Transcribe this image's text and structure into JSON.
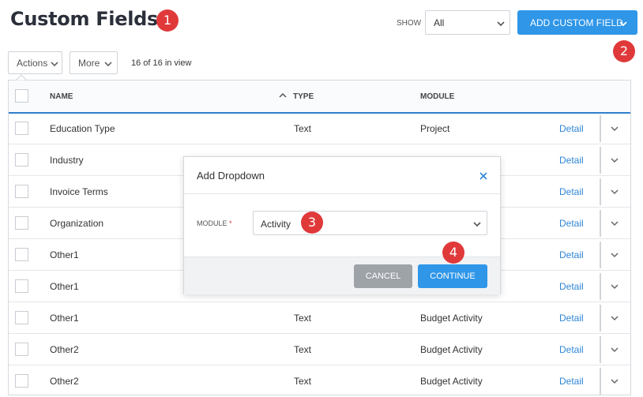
{
  "header": {
    "title": "Custom Fields",
    "show_label": "SHOW",
    "show_value": "All",
    "add_button": "ADD CUSTOM FIELD"
  },
  "toolbar": {
    "actions_label": "Actions",
    "more_label": "More",
    "in_view": "16 of 16 in view"
  },
  "table": {
    "headers": {
      "name": "NAME",
      "type": "TYPE",
      "module": "MODULE"
    },
    "detail_label": "Detail",
    "rows": [
      {
        "name": "Education Type",
        "type": "Text",
        "module": "Project"
      },
      {
        "name": "Industry",
        "type": "",
        "module": ""
      },
      {
        "name": "Invoice Terms",
        "type": "",
        "module": ""
      },
      {
        "name": "Organization",
        "type": "",
        "module": ""
      },
      {
        "name": "Other1",
        "type": "",
        "module": ""
      },
      {
        "name": "Other1",
        "type": "",
        "module": ""
      },
      {
        "name": "Other1",
        "type": "Text",
        "module": "Budget Activity"
      },
      {
        "name": "Other2",
        "type": "Text",
        "module": "Budget Activity"
      },
      {
        "name": "Other2",
        "type": "Text",
        "module": "Budget Activity"
      }
    ]
  },
  "modal": {
    "title": "Add Dropdown",
    "module_label": "MODULE",
    "required_mark": "*",
    "module_value": "Activity",
    "cancel_label": "CANCEL",
    "continue_label": "CONTINUE"
  },
  "annotations": {
    "b1": "1",
    "b2": "2",
    "b3": "3",
    "b4": "4"
  },
  "colors": {
    "accent": "#2f96e8",
    "badge": "#e0393a",
    "link": "#2f86d6"
  }
}
